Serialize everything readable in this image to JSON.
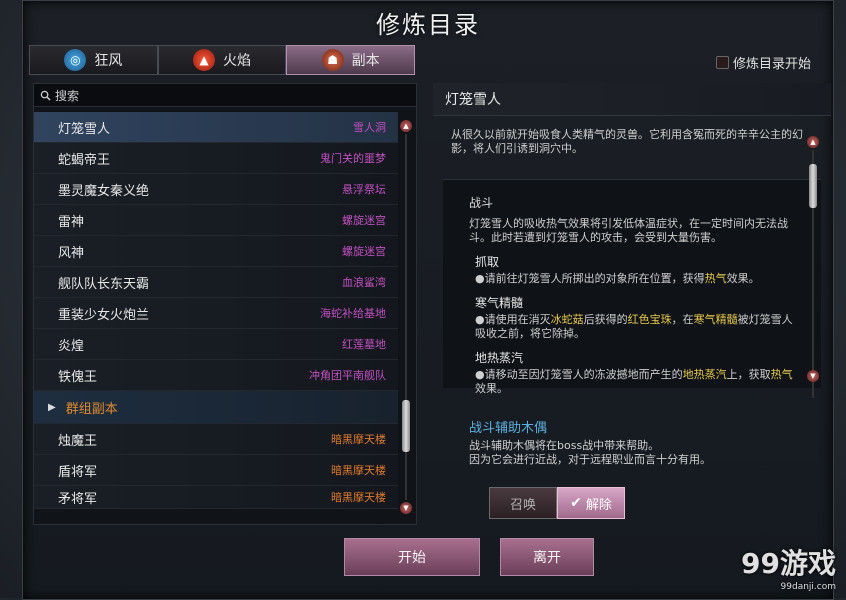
{
  "window": {
    "title": "修炼目录"
  },
  "tabs": [
    {
      "label": "狂风",
      "icon": "wind-icon"
    },
    {
      "label": "火焰",
      "icon": "fire-icon"
    },
    {
      "label": "副本",
      "icon": "dungeon-icon"
    }
  ],
  "checkbox": {
    "label": "修炼目录开始"
  },
  "search": {
    "placeholder": "搜索"
  },
  "list": {
    "items": [
      {
        "name": "灯笼雪人",
        "location": "雪人洞"
      },
      {
        "name": "蛇蝎帝王",
        "location": "鬼门关的噩梦"
      },
      {
        "name": "墨灵魔女秦义绝",
        "location": "悬浮祭坛"
      },
      {
        "name": "雷神",
        "location": "螺旋迷宫"
      },
      {
        "name": "风神",
        "location": "螺旋迷宫"
      },
      {
        "name": "舰队队长东天霸",
        "location": "血浪鲨湾"
      },
      {
        "name": "重装少女火炮兰",
        "location": "海蛇补给基地"
      },
      {
        "name": "炎煌",
        "location": "红莲墓地"
      },
      {
        "name": "铁傀王",
        "location": "冲角团平南舰队"
      }
    ],
    "group_label": "群组副本",
    "group_items": [
      {
        "name": "烛魔王",
        "location": "暗黑摩天楼"
      },
      {
        "name": "盾将军",
        "location": "暗黑摩天楼"
      },
      {
        "name": "矛将军",
        "location": "暗黑摩天楼"
      }
    ]
  },
  "detail": {
    "header": "灯笼雪人",
    "intro": "从很久以前就开始吸食人类精气的灵兽。它利用含冤而死的辛辛公主的幻影，将人们引诱到洞穴中。",
    "battle_title": "战斗",
    "battle_desc": "灯笼雪人的吸收热气效果将引发低体温症状，在一定时间内无法战斗。此时若遭到灯笼雪人的攻击，会受到大量伤害。",
    "sections": [
      {
        "title": "抓取",
        "text_a": "●请前往灯笼雪人所掷出的对象所在位置，获得",
        "hl_a": "热气",
        "text_b": "效果。"
      },
      {
        "title": "寒气精髓",
        "text_a": "●请使用在消灭",
        "hl_a": "冰蛇菇",
        "text_b": "后获得的",
        "hl_b": "红色宝珠",
        "text_c": "，在",
        "hl_c": "寒气精髓",
        "text_d": "被灯笼雪人吸收之前，将它除掉。"
      },
      {
        "title": "地热蒸汽",
        "text_a": "●请移动至因灯笼雪人的冻波撼地而产生的",
        "hl_a": "地热蒸汽",
        "text_b": "上，获取",
        "hl_b": "热气",
        "text_c": "效果。"
      }
    ],
    "helper_title": "战斗辅助木偶",
    "helper_desc_1": "战斗辅助木偶将在boss战中带来帮助。",
    "helper_desc_2": "因为它会进行近战，对于远程职业而言十分有用。",
    "summon_label": "召唤",
    "dismiss_label": "解除"
  },
  "footer": {
    "start_label": "开始",
    "leave_label": "离开"
  },
  "watermark": {
    "text": "99游戏",
    "sub": "99danji.com"
  }
}
